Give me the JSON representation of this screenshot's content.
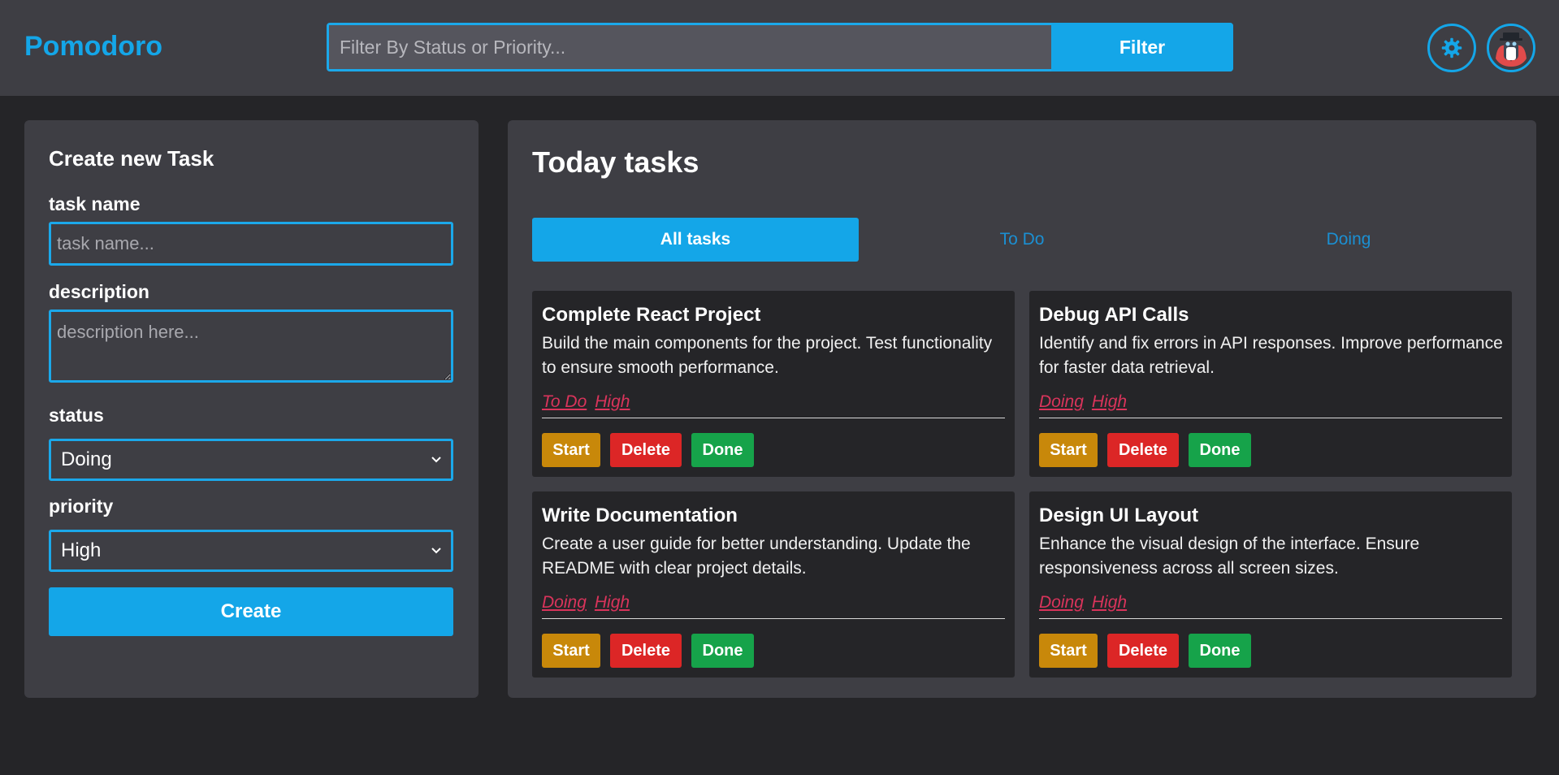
{
  "header": {
    "logo": "Pomodoro",
    "filter_placeholder": "Filter By Status or Priority...",
    "filter_button": "Filter",
    "settings_icon": "gear-icon",
    "avatar_icon": "avatar-icon"
  },
  "create_form": {
    "title": "Create new Task",
    "task_name_label": "task name",
    "task_name_placeholder": "task name...",
    "description_label": "description",
    "description_placeholder": "description here...",
    "status_label": "status",
    "status_value": "Doing",
    "priority_label": "priority",
    "priority_value": "High",
    "create_button": "Create"
  },
  "tasks_panel": {
    "title": "Today tasks",
    "tabs": [
      {
        "label": "All tasks",
        "active": true
      },
      {
        "label": "To Do",
        "active": false
      },
      {
        "label": "Doing",
        "active": false
      }
    ],
    "tasks": [
      {
        "name": "Complete React Project",
        "description": "Build the main components for the project. Test functionality to ensure smooth performance.",
        "status": "To Do",
        "priority": "High"
      },
      {
        "name": "Debug API Calls",
        "description": "Identify and fix errors in API responses. Improve performance for faster data retrieval.",
        "status": "Doing",
        "priority": "High"
      },
      {
        "name": "Write Documentation",
        "description": "Create a user guide for better understanding. Update the README with clear project details.",
        "status": "Doing",
        "priority": "High"
      },
      {
        "name": "Design UI Layout",
        "description": "Enhance the visual design of the interface. Ensure responsiveness across all screen sizes.",
        "status": "Doing",
        "priority": "High"
      }
    ],
    "actions": {
      "start": "Start",
      "delete": "Delete",
      "done": "Done"
    }
  },
  "colors": {
    "accent": "#14a6e8",
    "start": "#c8880a",
    "delete": "#dc2626",
    "done": "#16a34a",
    "tag": "#d9345b"
  }
}
